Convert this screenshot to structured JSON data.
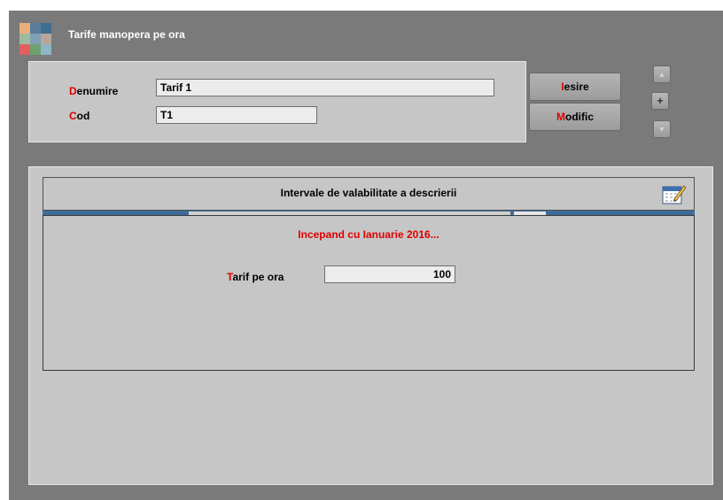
{
  "window": {
    "title": "Tarife manopera pe ora",
    "icon": "app-grid-icon",
    "icon_colors": [
      "#e8b07a",
      "#5a7c9a",
      "#3f6d93",
      "#9fb9a0",
      "#7fa0b5",
      "#b9a69a",
      "#e06060",
      "#6fa06f",
      "#8fb6c8"
    ]
  },
  "form": {
    "denumire_label_hot": "D",
    "denumire_label_rest": "enumire",
    "denumire_value": "Tarif 1",
    "cod_label_hot": "C",
    "cod_label_rest": "od",
    "cod_value": "T1"
  },
  "buttons": {
    "iesire_hot": "I",
    "iesire_rest": "esire",
    "modific_hot": "M",
    "modific_rest": "odific",
    "up_icon": "▲",
    "plus": "+",
    "down_icon": "▼"
  },
  "validity": {
    "header_title": "Intervale de valabilitate a descrierii",
    "calendar_icon": "calendar-edit-icon",
    "period_text": "Incepand cu Ianuarie 2016...",
    "tarif_label_hot": "T",
    "tarif_label_rest": "arif pe ora",
    "tarif_value": "100"
  },
  "colors": {
    "hotkey": "#e00000",
    "panel": "#c6c6c6",
    "frame": "#7a7a7a",
    "strip": "#3d6c99"
  }
}
